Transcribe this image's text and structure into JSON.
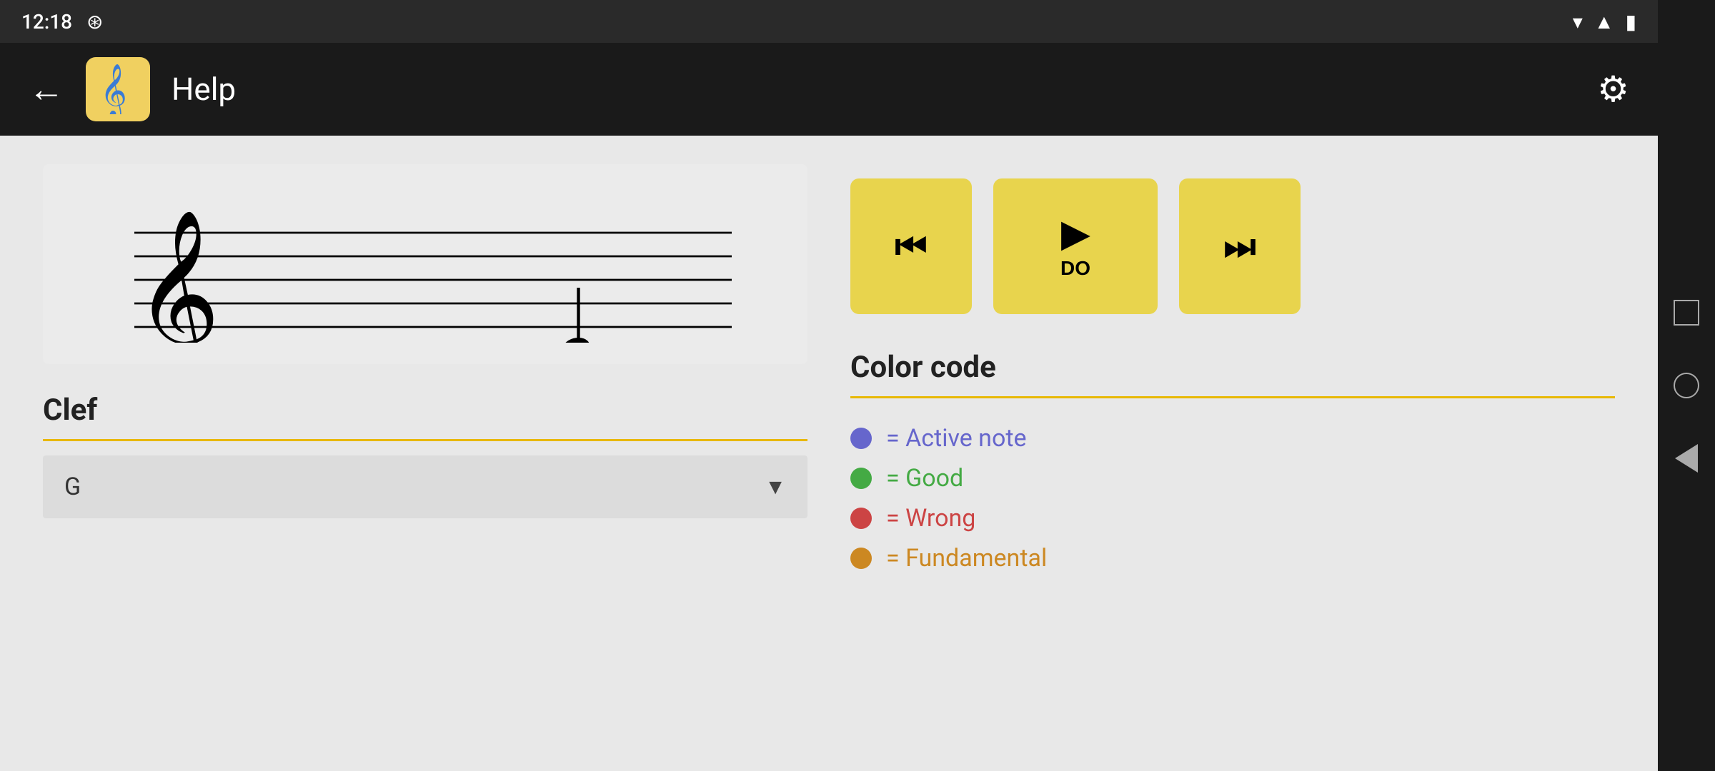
{
  "statusBar": {
    "time": "12:18",
    "shieldIcon": "🛡",
    "wifiIcon": "▼",
    "signalIcon": "▲",
    "batteryIcon": "🔋"
  },
  "appBar": {
    "backLabel": "←",
    "appIconEmoji": "🎵",
    "title": "Help",
    "settingsIcon": "⚙"
  },
  "playback": {
    "skipBackLabel": "⏮",
    "playLabel": "▶",
    "playNote": "DO",
    "skipFwdLabel": "⏭"
  },
  "clef": {
    "sectionTitle": "Clef",
    "dropdownValue": "G",
    "dropdownArrow": "▼"
  },
  "colorCode": {
    "sectionTitle": "Color code",
    "items": [
      {
        "dotClass": "dot-active",
        "labelClass": "color-label-active",
        "text": "= Active note"
      },
      {
        "dotClass": "dot-good",
        "labelClass": "color-label-good",
        "text": "= Good"
      },
      {
        "dotClass": "dot-wrong",
        "labelClass": "color-label-wrong",
        "text": "= Wrong"
      },
      {
        "dotClass": "dot-fundamental",
        "labelClass": "color-label-fundamental",
        "text": "= Fundamental"
      }
    ]
  }
}
